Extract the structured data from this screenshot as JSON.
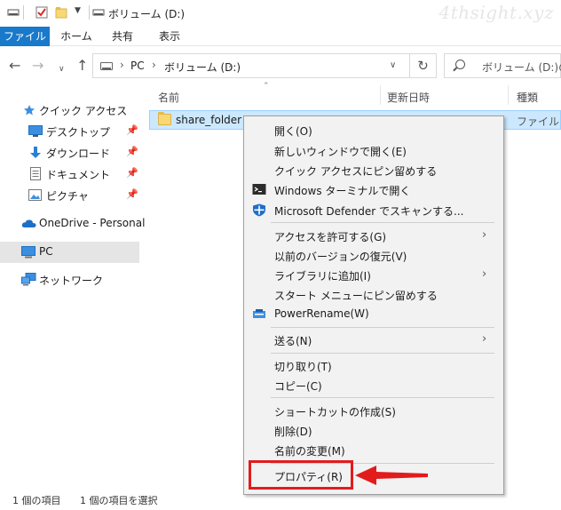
{
  "window": {
    "title": "ボリューム (D:)",
    "watermark": "4thsight.xyz"
  },
  "ribbon": {
    "tabs": [
      "ファイル",
      "ホーム",
      "共有",
      "表示"
    ]
  },
  "address": {
    "segments": [
      "PC",
      "ボリューム (D:)"
    ],
    "search_placeholder": "ボリューム (D:)の検"
  },
  "sidebar": {
    "items": [
      {
        "label": "クイック アクセス",
        "icon": "star-icon"
      },
      {
        "label": "デスクトップ",
        "icon": "desktop-icon",
        "pinned": true
      },
      {
        "label": "ダウンロード",
        "icon": "download-icon",
        "pinned": true
      },
      {
        "label": "ドキュメント",
        "icon": "document-icon",
        "pinned": true
      },
      {
        "label": "ピクチャ",
        "icon": "picture-icon",
        "pinned": true
      },
      {
        "label": "OneDrive - Personal",
        "icon": "cloud-icon"
      },
      {
        "label": "PC",
        "icon": "computer-icon",
        "selected": true
      },
      {
        "label": "ネットワーク",
        "icon": "network-icon"
      }
    ]
  },
  "columns": {
    "name": "名前",
    "modified": "更新日時",
    "type": "種類"
  },
  "files": [
    {
      "name": "share_folder",
      "type": "ファイル フォ"
    }
  ],
  "status": {
    "count": "1 個の項目",
    "selected": "1 個の項目を選択"
  },
  "context_menu": {
    "items": [
      {
        "label": "開く(O)"
      },
      {
        "label": "新しいウィンドウで開く(E)"
      },
      {
        "label": "クイック アクセスにピン留めする"
      },
      {
        "label": "Windows ターミナルで開く",
        "icon": "terminal-icon"
      },
      {
        "label": "Microsoft Defender でスキャンする...",
        "icon": "defender-shield-icon"
      },
      {
        "label": "アクセスを許可する(G)",
        "submenu": true
      },
      {
        "label": "以前のバージョンの復元(V)"
      },
      {
        "label": "ライブラリに追加(I)",
        "submenu": true
      },
      {
        "label": "スタート メニューにピン留めする"
      },
      {
        "label": "PowerRename(W)",
        "icon": "powerrename-icon"
      },
      {
        "label": "送る(N)",
        "submenu": true
      },
      {
        "label": "切り取り(T)"
      },
      {
        "label": "コピー(C)"
      },
      {
        "label": "ショートカットの作成(S)"
      },
      {
        "label": "削除(D)"
      },
      {
        "label": "名前の変更(M)"
      },
      {
        "label": "プロパティ(R)"
      }
    ]
  },
  "colors": {
    "accent": "#1979ca",
    "selection": "#cce8ff",
    "highlight": "#e21c1c"
  }
}
